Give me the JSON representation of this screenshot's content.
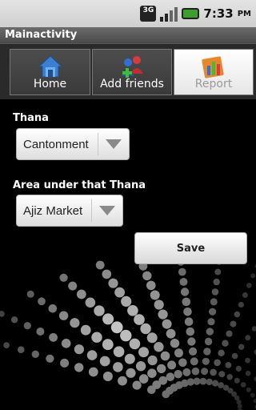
{
  "status_bar": {
    "network_label": "3G",
    "time": "7:33",
    "ampm": "PM",
    "icons": [
      "network-3g-icon",
      "signal-icon",
      "battery-icon"
    ]
  },
  "app": {
    "title": "Mainactivity"
  },
  "tabs": [
    {
      "label": "Home",
      "icon": "home-icon",
      "active": false
    },
    {
      "label": "Add friends",
      "icon": "add-friends-icon",
      "active": false
    },
    {
      "label": "Report",
      "icon": "report-icon",
      "active": true
    }
  ],
  "form": {
    "thana_label": "Thana",
    "thana_value": "Cantonment",
    "area_label": "Area under that Thana",
    "area_value": "Ajiz Market",
    "save_label": "Save"
  },
  "colors": {
    "background": "#000000",
    "title_bar": "#5a5a5a",
    "tab_inactive": "#444444",
    "tab_active": "#f2f2f2"
  }
}
